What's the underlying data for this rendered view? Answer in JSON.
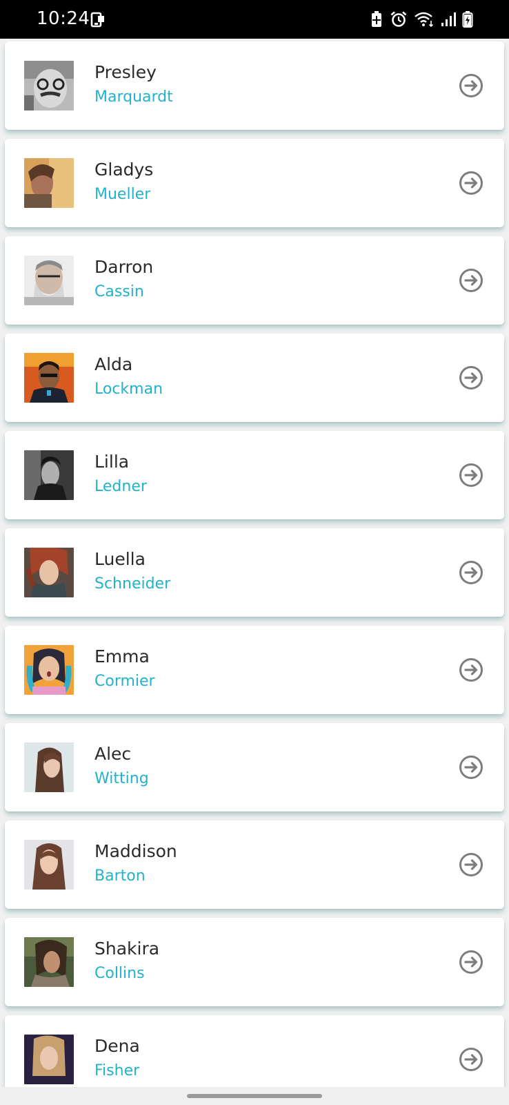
{
  "status_bar": {
    "time": "10:24",
    "icons": [
      "screenshot-icon",
      "battery-saver-icon",
      "alarm-icon",
      "wifi-icon",
      "signal-icon",
      "battery-charging-icon"
    ]
  },
  "colors": {
    "last_name": "#22b2c9",
    "first_name": "#2a2a2a",
    "arrow": "#7d7d7d",
    "background": "#f1f1f1"
  },
  "contacts": [
    {
      "first": "Presley",
      "last": "Marquardt",
      "avatar": "avatar-photo"
    },
    {
      "first": "Gladys",
      "last": "Mueller",
      "avatar": "avatar-photo"
    },
    {
      "first": "Darron",
      "last": "Cassin",
      "avatar": "avatar-photo"
    },
    {
      "first": "Alda",
      "last": "Lockman",
      "avatar": "avatar-photo"
    },
    {
      "first": "Lilla",
      "last": "Ledner",
      "avatar": "avatar-photo"
    },
    {
      "first": "Luella",
      "last": "Schneider",
      "avatar": "avatar-photo"
    },
    {
      "first": "Emma",
      "last": "Cormier",
      "avatar": "avatar-photo"
    },
    {
      "first": "Alec",
      "last": "Witting",
      "avatar": "avatar-photo"
    },
    {
      "first": "Maddison",
      "last": "Barton",
      "avatar": "avatar-photo"
    },
    {
      "first": "Shakira",
      "last": "Collins",
      "avatar": "avatar-photo"
    },
    {
      "first": "Dena",
      "last": "Fisher",
      "avatar": "avatar-photo"
    }
  ]
}
